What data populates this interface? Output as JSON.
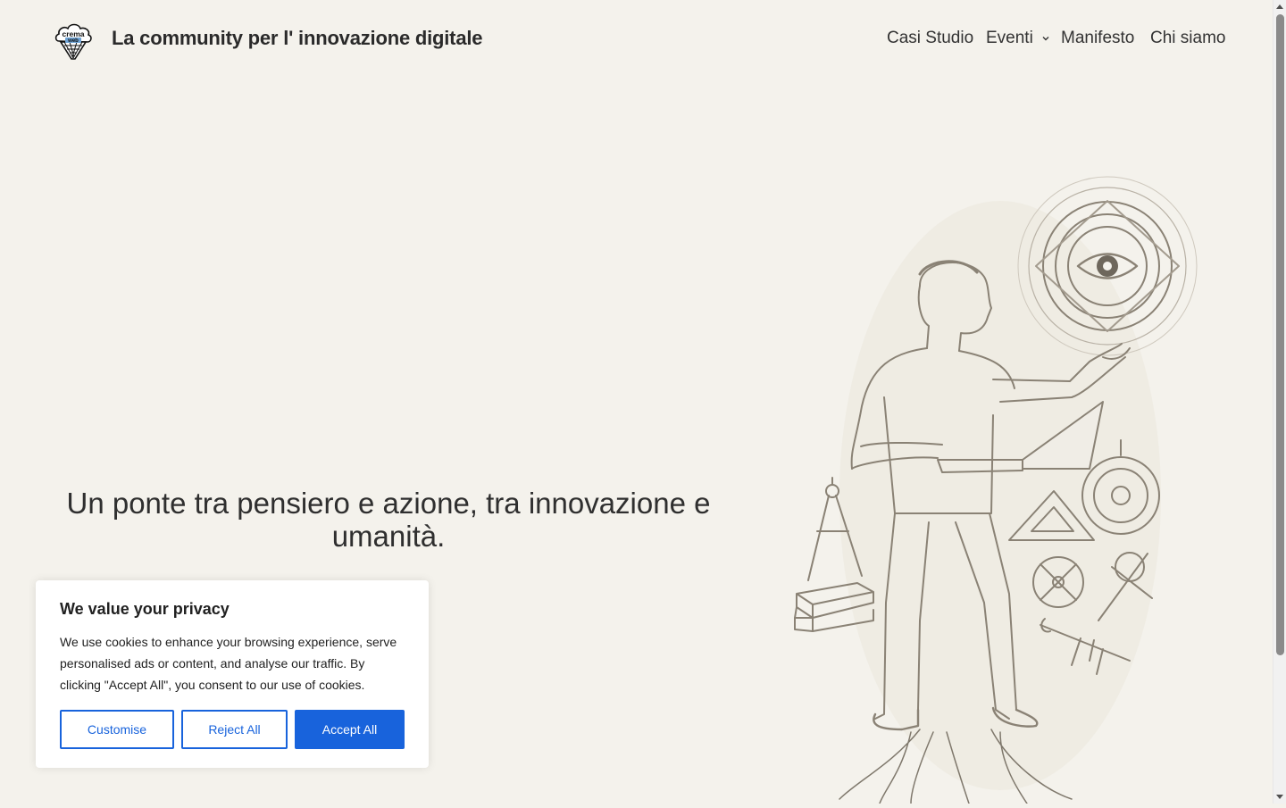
{
  "header": {
    "logo_text_top": "crema",
    "logo_text_bottom": "web",
    "site_title": "La community per l' innovazione digitale",
    "nav": [
      {
        "label": "Casi Studio"
      },
      {
        "label": "Eventi",
        "has_dropdown": true
      },
      {
        "label": "Manifesto"
      },
      {
        "label": "Chi siamo"
      }
    ]
  },
  "hero": {
    "headline": "Un ponte tra pensiero e azione, tra innovazione e umanità.",
    "illustration_icon": "sketch-man-with-laptop-and-geometric-tools"
  },
  "cookie_banner": {
    "title": "We value your privacy",
    "text": "We use cookies to enhance your browsing experience, serve personalised ads or content, and analyse our traffic. By clicking \"Accept All\", you consent to our use of cookies.",
    "customise_label": "Customise",
    "reject_label": "Reject All",
    "accept_label": "Accept All"
  },
  "colors": {
    "background": "#f4f2ec",
    "accent": "#1863dc",
    "text": "#2b2b2b",
    "sketch": "#8a8275"
  }
}
